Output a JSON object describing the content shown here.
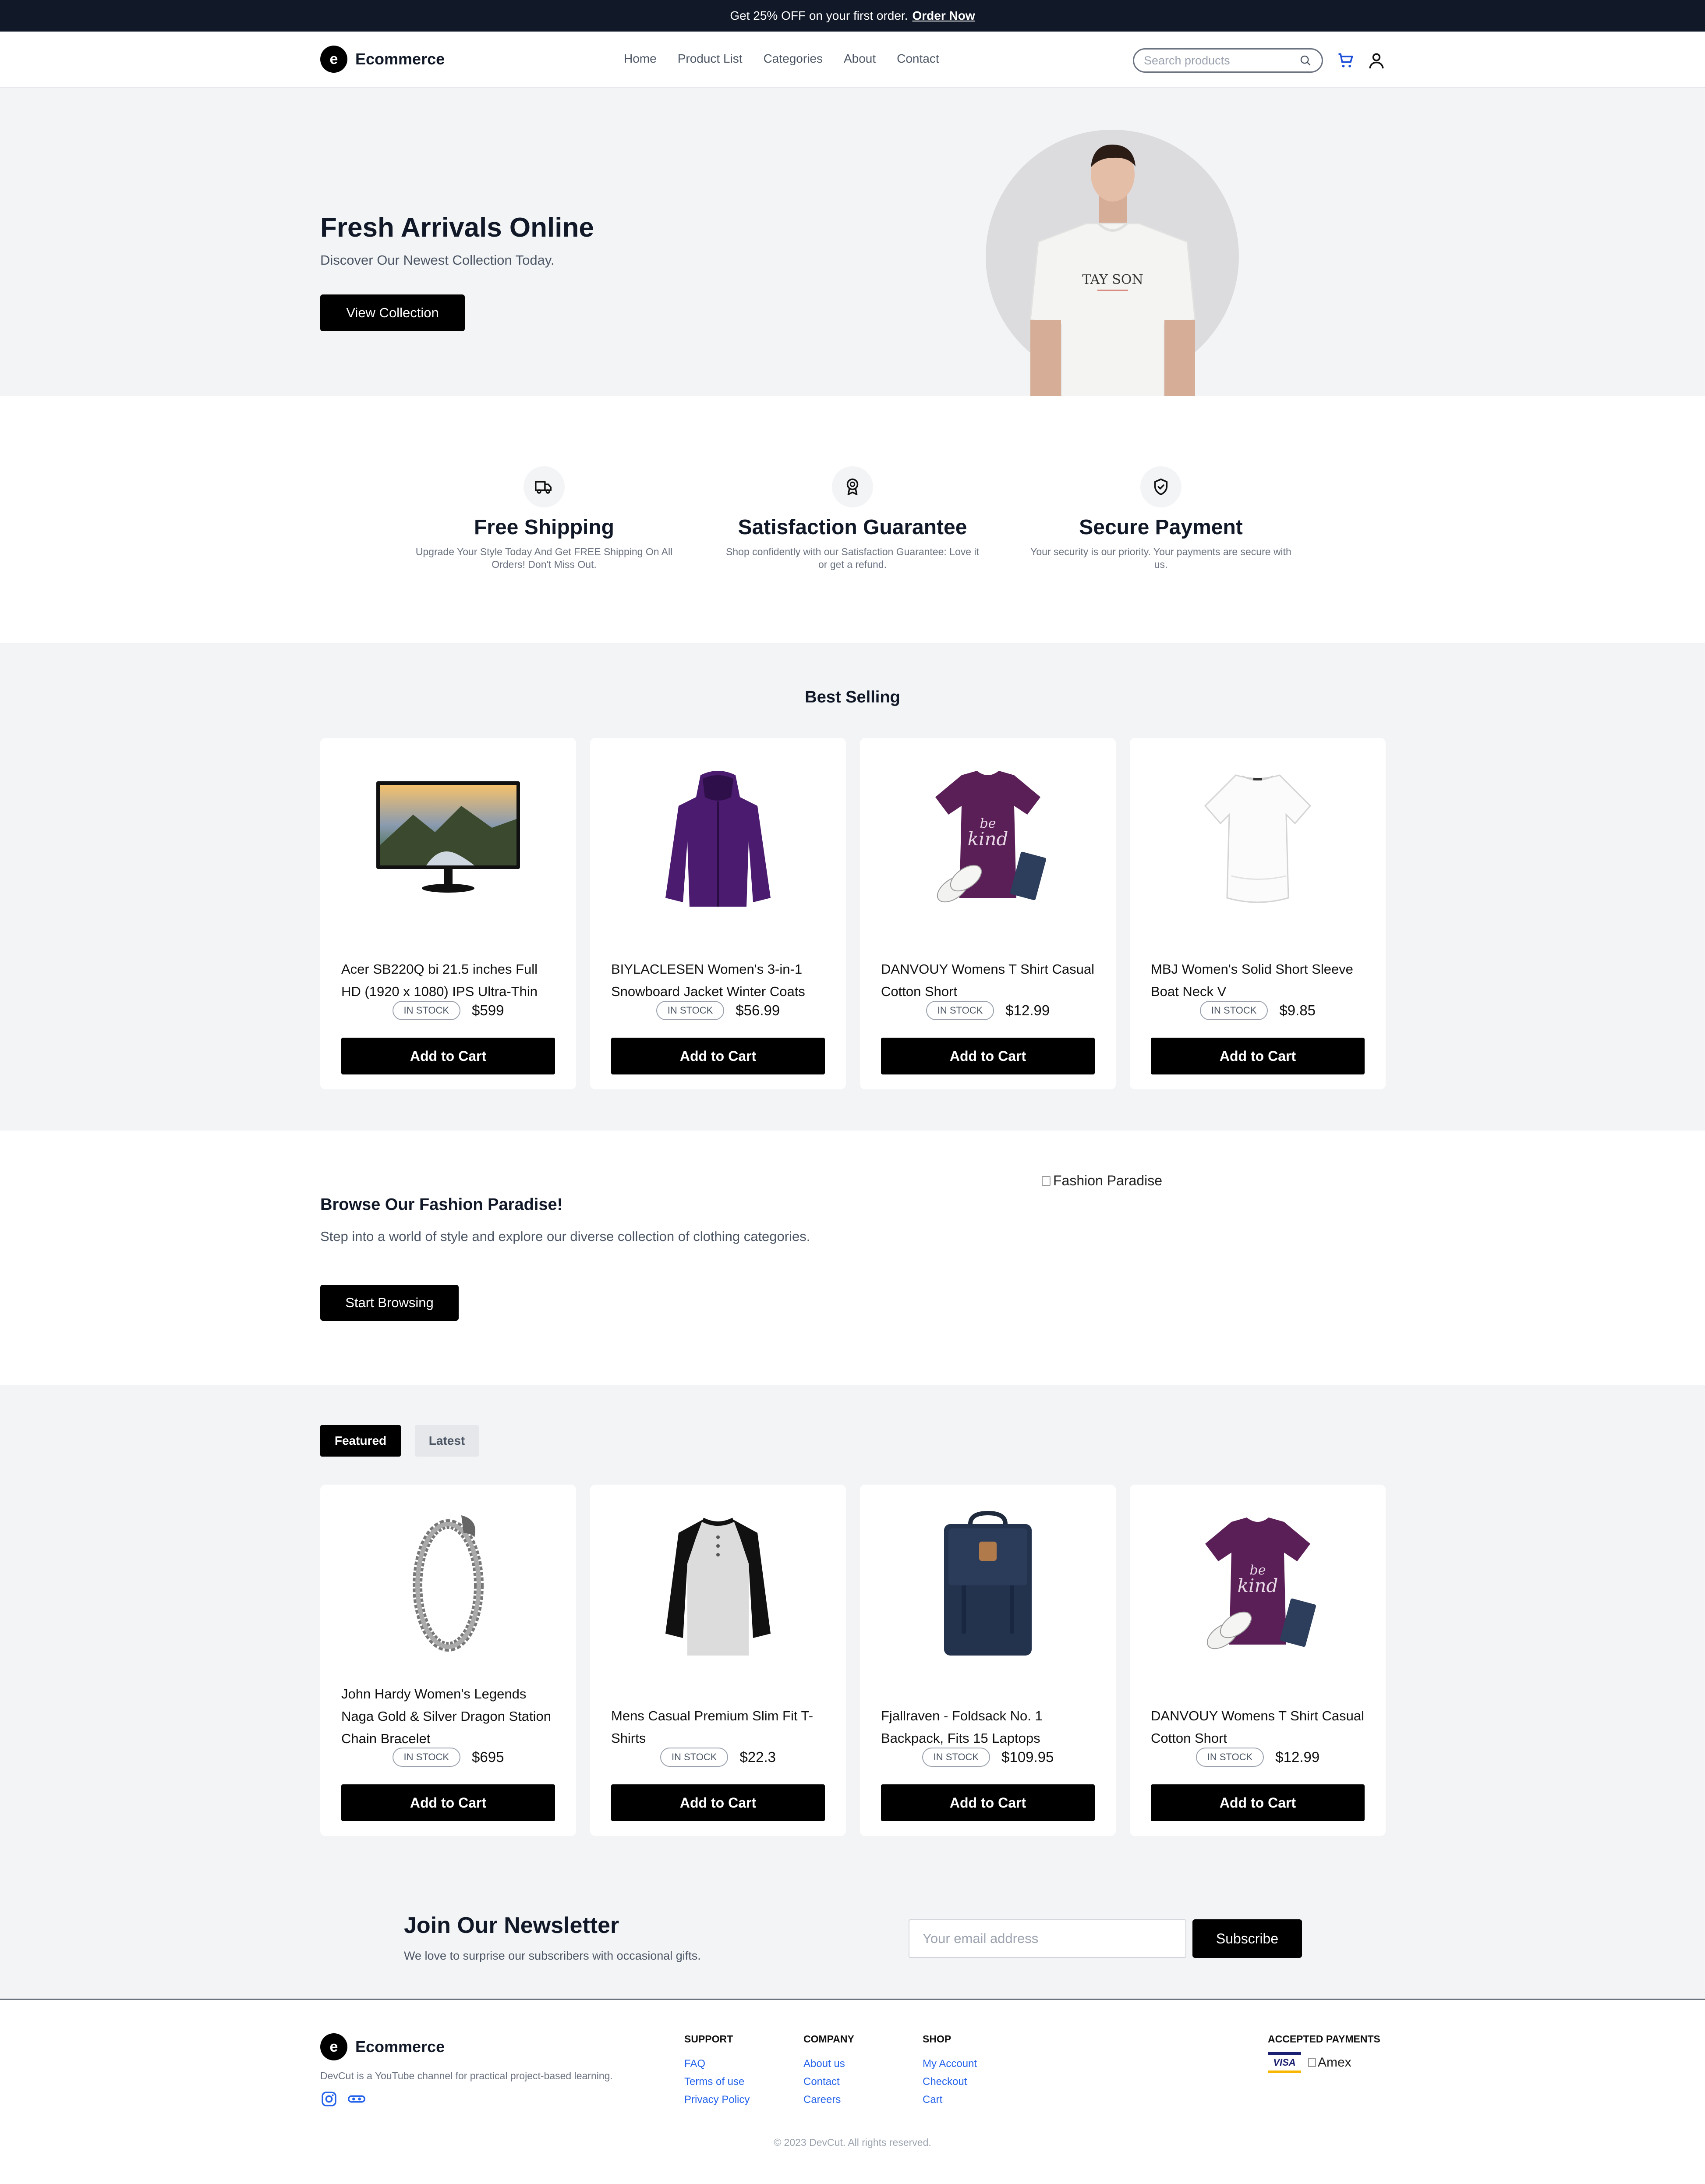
{
  "announcement": {
    "text": "Get 25% OFF on your first order.",
    "cta": "Order Now"
  },
  "header": {
    "logo_letter": "e",
    "brand": "Ecommerce",
    "nav": [
      "Home",
      "Product List",
      "Categories",
      "About",
      "Contact"
    ],
    "search_placeholder": "Search products"
  },
  "hero": {
    "title": "Fresh Arrivals Online",
    "subtitle": "Discover Our Newest Collection Today.",
    "button": "View Collection",
    "shirt_text": "TAY SON"
  },
  "features": [
    {
      "icon": "truck-icon",
      "title": "Free Shipping",
      "text": "Upgrade Your Style Today And Get FREE Shipping On All Orders! Don't Miss Out."
    },
    {
      "icon": "award-icon",
      "title": "Satisfaction Guarantee",
      "text": "Shop confidently with our Satisfaction Guarantee: Love it or get a refund."
    },
    {
      "icon": "shield-check-icon",
      "title": "Secure Payment",
      "text": "Your security is our priority. Your payments are secure with us."
    }
  ],
  "best_selling": {
    "title": "Best Selling",
    "products": [
      {
        "name": "Acer SB220Q bi 21.5 inches Full HD (1920 x 1080) IPS Ultra-Thin",
        "status": "IN STOCK",
        "price": "$599",
        "button": "Add to Cart",
        "image": "monitor"
      },
      {
        "name": "BIYLACLESEN Women's 3-in-1 Snowboard Jacket Winter Coats",
        "status": "IN STOCK",
        "price": "$56.99",
        "button": "Add to Cart",
        "image": "jacket"
      },
      {
        "name": "DANVOUY Womens T Shirt Casual Cotton Short",
        "status": "IN STOCK",
        "price": "$12.99",
        "button": "Add to Cart",
        "image": "purple-tshirt"
      },
      {
        "name": "MBJ Women's Solid Short Sleeve Boat Neck V",
        "status": "IN STOCK",
        "price": "$9.85",
        "button": "Add to Cart",
        "image": "white-top"
      }
    ]
  },
  "browse": {
    "title": "Browse Our Fashion Paradise!",
    "text": "Step into a world of style and explore our diverse collection of clothing categories.",
    "button": "Start Browsing",
    "image_alt": "Fashion Paradise"
  },
  "tabs": {
    "featured": "Featured",
    "latest": "Latest"
  },
  "featured": {
    "products": [
      {
        "name": "John Hardy Women's Legends Naga Gold & Silver Dragon Station Chain Bracelet",
        "status": "IN STOCK",
        "price": "$695",
        "button": "Add to Cart",
        "image": "bracelet"
      },
      {
        "name": "Mens Casual Premium Slim Fit T-Shirts",
        "status": "IN STOCK",
        "price": "$22.3",
        "button": "Add to Cart",
        "image": "raglan-shirt"
      },
      {
        "name": "Fjallraven - Foldsack No. 1 Backpack, Fits 15 Laptops",
        "status": "IN STOCK",
        "price": "$109.95",
        "button": "Add to Cart",
        "image": "backpack"
      },
      {
        "name": "DANVOUY Womens T Shirt Casual Cotton Short",
        "status": "IN STOCK",
        "price": "$12.99",
        "button": "Add to Cart",
        "image": "purple-tshirt"
      }
    ]
  },
  "newsletter": {
    "title": "Join Our Newsletter",
    "text": "We love to surprise our subscribers with occasional gifts.",
    "placeholder": "Your email address",
    "button": "Subscribe"
  },
  "footer": {
    "brand": "Ecommerce",
    "logo_letter": "e",
    "description": "DevCut is a YouTube channel for practical project-based learning.",
    "columns": [
      {
        "title": "SUPPORT",
        "links": [
          "FAQ",
          "Terms of use",
          "Privacy Policy"
        ]
      },
      {
        "title": "COMPANY",
        "links": [
          "About us",
          "Contact",
          "Careers"
        ]
      },
      {
        "title": "SHOP",
        "links": [
          "My Account",
          "Checkout",
          "Cart"
        ]
      }
    ],
    "payments_title": "ACCEPTED PAYMENTS",
    "visa": "VISA",
    "amex_alt": "Amex",
    "copyright": "© 2023 DevCut. All rights reserved."
  },
  "colors": {
    "dark": "#111827",
    "button": "#000000",
    "section_bg": "#f3f4f6",
    "link": "#2563eb"
  }
}
